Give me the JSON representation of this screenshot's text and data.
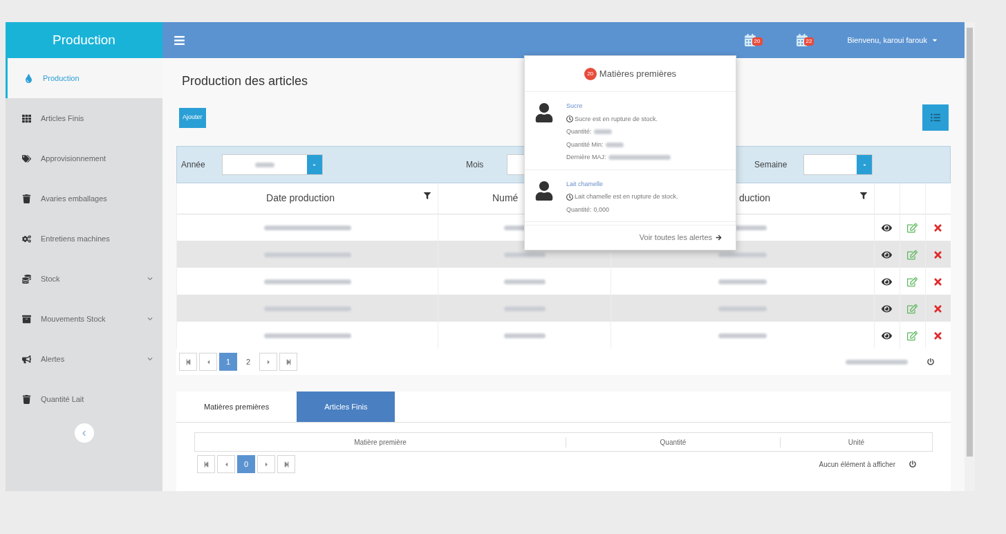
{
  "sidebar": {
    "brand": "Production",
    "items": [
      {
        "label": "Production",
        "selected": true,
        "expandable": false
      },
      {
        "label": "Articles Finis",
        "selected": false,
        "expandable": false
      },
      {
        "label": "Approvisionnement",
        "selected": false,
        "expandable": false
      },
      {
        "label": "Avaries emballages",
        "selected": false,
        "expandable": false
      },
      {
        "label": "Entretiens machines",
        "selected": false,
        "expandable": false
      },
      {
        "label": "Stock",
        "selected": false,
        "expandable": true
      },
      {
        "label": "Mouvements Stock",
        "selected": false,
        "expandable": true
      },
      {
        "label": "Alertes",
        "selected": false,
        "expandable": true
      },
      {
        "label": "Quantité Lait",
        "selected": false,
        "expandable": false
      }
    ]
  },
  "topbar": {
    "notifications": [
      {
        "count": "20"
      },
      {
        "count": "22"
      }
    ],
    "user": "Bienvenu, karoui farouk"
  },
  "alerts_popup": {
    "count": "20",
    "title": "Matières premières",
    "items": [
      {
        "name": "Sucre",
        "message": "Sucre est en rupture de stock.",
        "fields": [
          {
            "label": "Quantité:"
          },
          {
            "label": "Quantité Min:"
          },
          {
            "label": "Dernière MAJ:"
          }
        ]
      },
      {
        "name": "Lait chamelle",
        "message": "Lait chamelle est en rupture de stock.",
        "fields": [
          {
            "label": "Quantité:",
            "value": "0,000"
          }
        ]
      }
    ],
    "footer": "Voir toutes les alertes"
  },
  "page": {
    "title": "Production des articles",
    "add_button": "Ajouter",
    "filters": [
      {
        "label": "Année"
      },
      {
        "label": "Mois"
      },
      {
        "label": "Semaine"
      }
    ],
    "table": {
      "columns": [
        "Date production",
        "Numé",
        "duction"
      ],
      "rows": [
        {
          "shaded": false
        },
        {
          "shaded": true
        },
        {
          "shaded": false
        },
        {
          "shaded": true
        },
        {
          "shaded": false
        }
      ]
    },
    "pager": {
      "pages": [
        {
          "label": "1",
          "selected": true
        },
        {
          "label": "2",
          "selected": false
        }
      ]
    }
  },
  "detail": {
    "tabs": [
      {
        "label": "Matières premières",
        "selected": false
      },
      {
        "label": "Articles Finis",
        "selected": true
      }
    ],
    "columns": [
      "Matière première",
      "Quantité",
      "Unité"
    ],
    "pager": {
      "pages": [
        {
          "label": "0",
          "selected": true
        }
      ]
    },
    "empty": "Aucun élément à afficher"
  }
}
